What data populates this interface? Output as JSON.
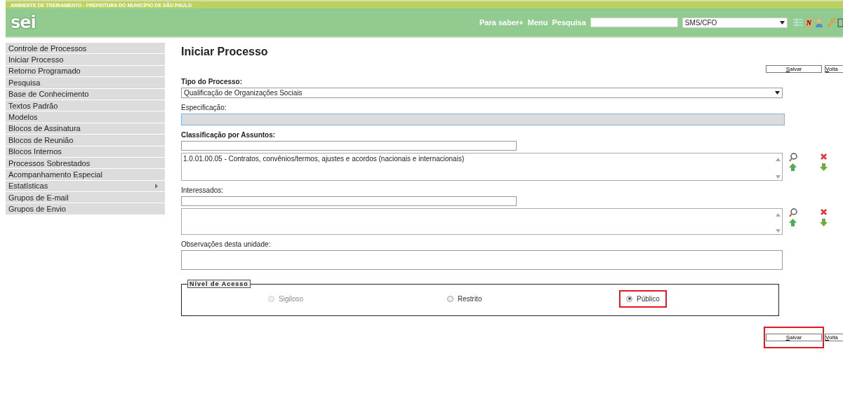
{
  "banner": {
    "title": "AMBIENTE DE TREINAMENTO - PREFEITURA DO MUNICÍPIO DE SÃO PAULO"
  },
  "header": {
    "logo": "sei",
    "links": [
      "Para saber+",
      "Menu",
      "Pesquisa"
    ],
    "unit": "SMS/CFO",
    "n_badge": "N"
  },
  "sidebar": {
    "items": [
      {
        "label": "Controle de Processos",
        "submenu": false
      },
      {
        "label": "Iniciar Processo",
        "submenu": false
      },
      {
        "label": "Retorno Programado",
        "submenu": false
      },
      {
        "label": "Pesquisa",
        "submenu": false
      },
      {
        "label": "Base de Conhecimento",
        "submenu": false
      },
      {
        "label": "Textos Padrão",
        "submenu": false
      },
      {
        "label": "Modelos",
        "submenu": false
      },
      {
        "label": "Blocos de Assinatura",
        "submenu": false
      },
      {
        "label": "Blocos de Reunião",
        "submenu": false
      },
      {
        "label": "Blocos Internos",
        "submenu": false
      },
      {
        "label": "Processos Sobrestados",
        "submenu": false
      },
      {
        "label": "Acompanhamento Especial",
        "submenu": false
      },
      {
        "label": "Estatísticas",
        "submenu": true
      },
      {
        "label": "Grupos de E-mail",
        "submenu": false
      },
      {
        "label": "Grupos de Envio",
        "submenu": false
      }
    ]
  },
  "page": {
    "title": "Iniciar Processo",
    "top_buttons": [
      {
        "label": "Salvar",
        "highlighted": false
      },
      {
        "label": "Volta",
        "highlighted": false
      }
    ],
    "tipo": {
      "label": "Tipo do Processo:",
      "value": "Qualificação de Organizações Sociais"
    },
    "especificacao": {
      "label": "Especificação:"
    },
    "classificacao": {
      "label": "Classificação por Assuntos:",
      "items": [
        "1.0.01.00.05 - Contratos, convênios/termos, ajustes e acordos (nacionais e internacionais)"
      ]
    },
    "interessados": {
      "label": "Interessados:"
    },
    "observacoes": {
      "label": "Observações desta unidade:"
    },
    "nivel_acesso": {
      "legend": "Nível de Acesso",
      "options": [
        {
          "label": "Sigiloso",
          "selected": false,
          "disabled": true,
          "highlighted": false
        },
        {
          "label": "Restrito",
          "selected": false,
          "disabled": false,
          "highlighted": false
        },
        {
          "label": "Público",
          "selected": true,
          "disabled": false,
          "highlighted": true
        }
      ]
    },
    "bottom_buttons": [
      {
        "label": "Salvar",
        "highlighted": true
      },
      {
        "label": "Volta",
        "highlighted": false
      }
    ]
  }
}
